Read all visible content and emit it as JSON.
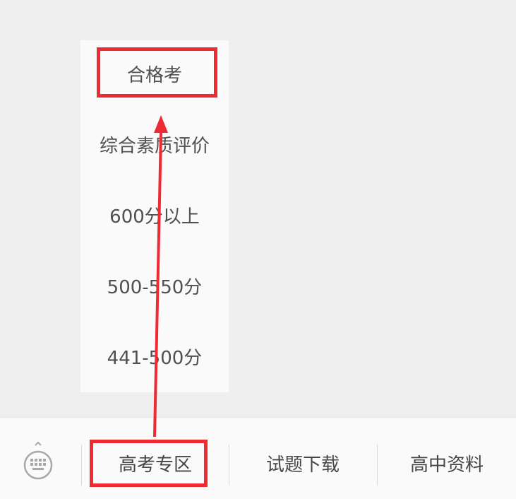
{
  "submenu": {
    "items": [
      {
        "label": "合格考"
      },
      {
        "label": "综合素质评价"
      },
      {
        "label": "600分以上"
      },
      {
        "label": "500-550分"
      },
      {
        "label": "441-500分"
      }
    ]
  },
  "bottom_bar": {
    "keyboard_icon": "keyboard-icon",
    "tabs": [
      {
        "label": "高考专区"
      },
      {
        "label": "试题下载"
      },
      {
        "label": "高中资料"
      }
    ]
  },
  "colors": {
    "annotation": "#ee2a35",
    "menu_bg": "#fafafa",
    "page_bg": "#efefef"
  }
}
